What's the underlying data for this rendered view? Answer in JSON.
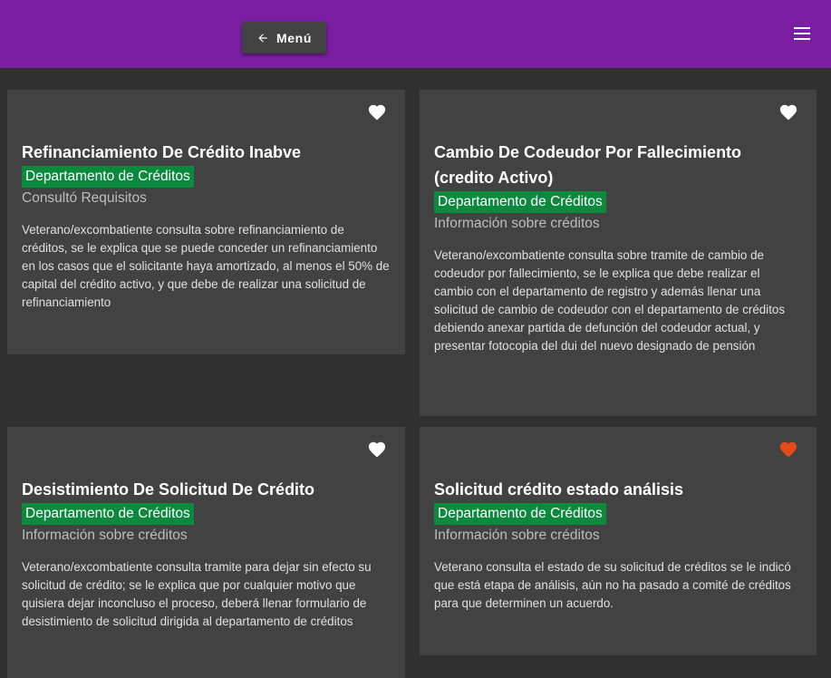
{
  "header": {
    "menu_label": "Menú"
  },
  "colors": {
    "header_bg": "#7b1fa2",
    "card_bg": "#424242",
    "page_bg": "#303030",
    "department_badge": "#0b8a3e",
    "favorite_active": "#e64a19",
    "favorite_inactive": "#ffffff"
  },
  "cards": [
    {
      "title": "Refinanciamiento De Crédito Inabve",
      "department": "Departamento de Créditos",
      "subtitle": "Consultó Requisitos",
      "description": "Veterano/excombatiente consulta sobre refinanciamiento de créditos, se le explica que se puede conceder un refinanciamiento en los casos que el solicitante haya amortizado, al menos el 50% de capital del crédito activo, y que debe de realizar una solicitud de refinanciamiento",
      "favorite": false,
      "favorite_icon": "heart-icon"
    },
    {
      "title": "Cambio De Codeudor Por Fallecimiento (credito Activo)",
      "department": "Departamento de Créditos",
      "subtitle": "Información sobre créditos",
      "description": "Veterano/excombatiente consulta sobre tramite de cambio de codeudor por fallecimiento, se le explica que debe realizar el cambio con el departamento de registro y además llenar una solicitud de cambio de codeudor con el departamento de créditos debiendo anexar partida de defunción del codeudor actual, y presentar fotocopia del dui del nuevo designado de pensión",
      "favorite": false,
      "favorite_icon": "heart-icon"
    },
    {
      "title": "Desistimiento De Solicitud De Crédito",
      "department": "Departamento de Créditos",
      "subtitle": "Información sobre créditos",
      "description": "Veterano/excombatiente consulta tramite para dejar sin efecto su solicitud de crédito; se le explica que por cualquier motivo que quisiera dejar inconcluso el proceso, deberá llenar formulario de desistimiento de solicitud dirigida al departamento de créditos",
      "favorite": false,
      "favorite_icon": "heart-icon"
    },
    {
      "title": "Solicitud crédito estado análisis",
      "department": "Departamento de Créditos",
      "subtitle": "Información sobre créditos",
      "description": "Veterano consulta el estado de su solicitud de créditos se le indicó que está etapa de análisis, aún no ha pasado a comité de créditos para que determinen un acuerdo.",
      "favorite": true,
      "favorite_icon": "heart-icon"
    }
  ]
}
